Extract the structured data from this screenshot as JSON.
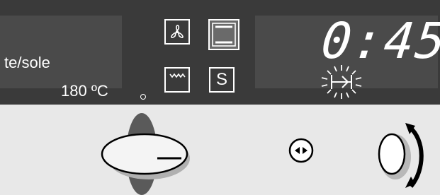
{
  "display_left": {
    "program_label": "te/sole",
    "temperature": "180 ºC"
  },
  "mode_buttons": [
    {
      "name": "fan",
      "icon": "fan-icon"
    },
    {
      "name": "top-bottom-heat",
      "icon": "top-bottom-heat-icon",
      "active": true
    },
    {
      "name": "grill",
      "icon": "grill-icon"
    },
    {
      "name": "special",
      "label": "S"
    }
  ],
  "display_right": {
    "timer_value": "0:45",
    "indicator_icon": "end-time-blinking-icon"
  },
  "controls": {
    "main_knob": "selector-knob",
    "arrow_button": "left-right-arrow-button",
    "rotary_knob": "rotary-knob-with-arrow"
  },
  "colors": {
    "panel": "#3a3a3a",
    "display": "#4a4a4a",
    "text": "#ffffff",
    "lower_panel": "#e8e8e8"
  }
}
